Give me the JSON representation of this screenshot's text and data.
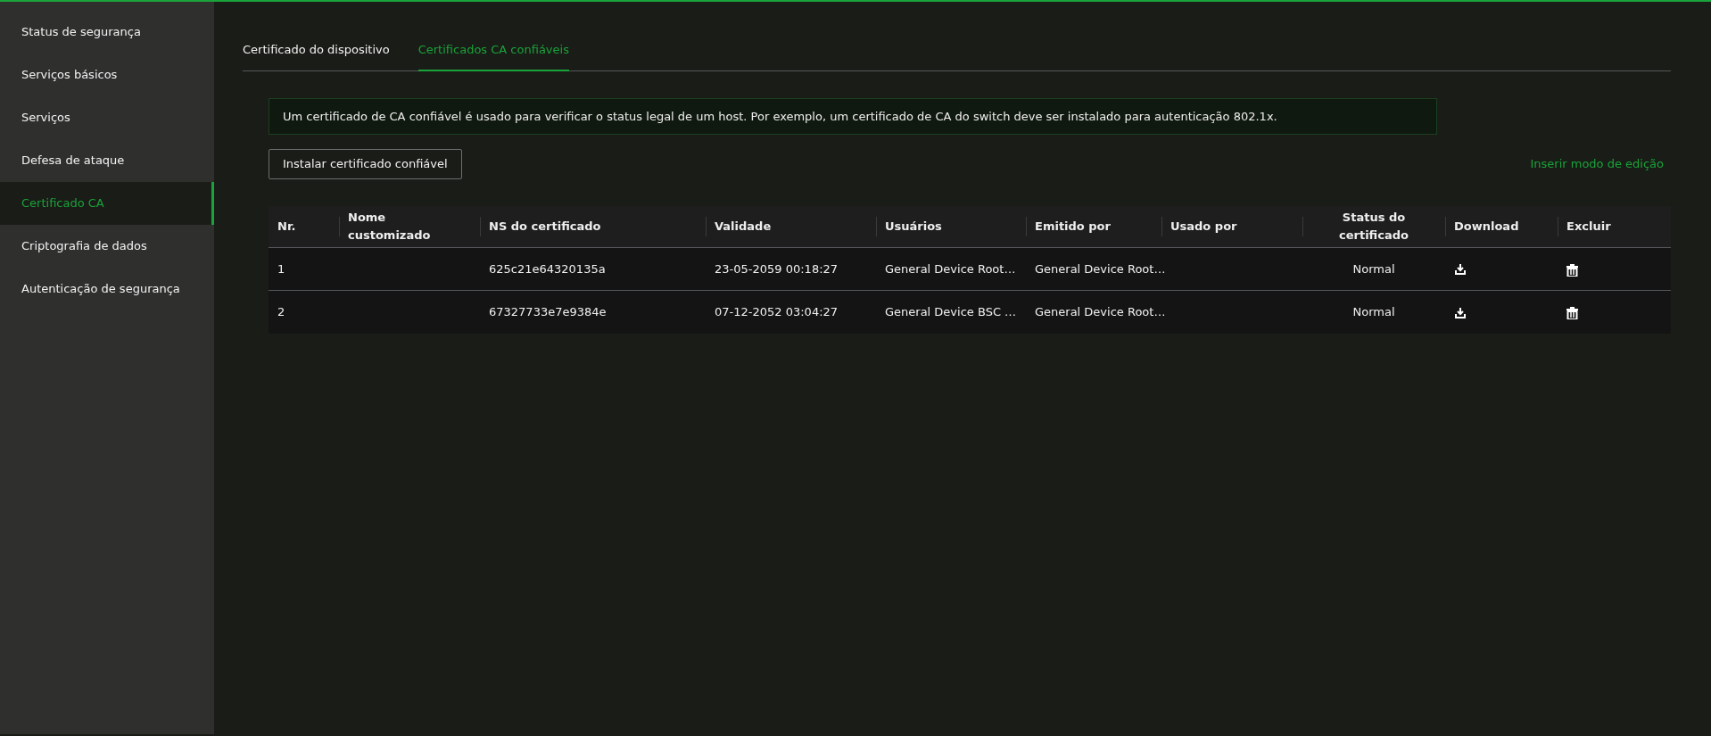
{
  "sidebar": {
    "items": [
      {
        "label": "Status de segurança",
        "selected": false
      },
      {
        "label": "Serviços básicos",
        "selected": false
      },
      {
        "label": "Serviços",
        "selected": false
      },
      {
        "label": "Defesa de ataque",
        "selected": false
      },
      {
        "label": "Certificado CA",
        "selected": true
      },
      {
        "label": "Criptografia de dados",
        "selected": false
      },
      {
        "label": "Autenticação de segurança",
        "selected": false
      }
    ]
  },
  "tabs": [
    {
      "label": "Certificado do dispositivo",
      "selected": false
    },
    {
      "label": "Certificados CA confiáveis",
      "selected": true
    }
  ],
  "info": "Um certificado de CA confiável é usado para verificar o status legal de um host. Por exemplo, um certificado de CA do switch deve ser instalado para autenticação 802.1x.",
  "install_button": "Instalar certificado confiável",
  "edit_mode_link": "Inserir modo de edição",
  "table": {
    "columns": [
      "Nr.",
      "Nome customizado",
      "NS do certificado",
      "Validade",
      "Usuários",
      "Emitido por",
      "Usado por",
      "Status do certificado",
      "Download",
      "Excluir"
    ],
    "rows": [
      {
        "nr": "1",
        "name": "",
        "serial": "625c21e64320135a",
        "validity": "23-05-2059 00:18:27",
        "users": "General Device Root…",
        "issued_by": "General Device Root…",
        "used_by": "",
        "status": "Normal"
      },
      {
        "nr": "2",
        "name": "",
        "serial": "67327733e7e9384e",
        "validity": "07-12-2052 03:04:27",
        "users": "General Device BSC …",
        "issued_by": "General Device Root…",
        "used_by": "",
        "status": "Normal"
      }
    ]
  }
}
